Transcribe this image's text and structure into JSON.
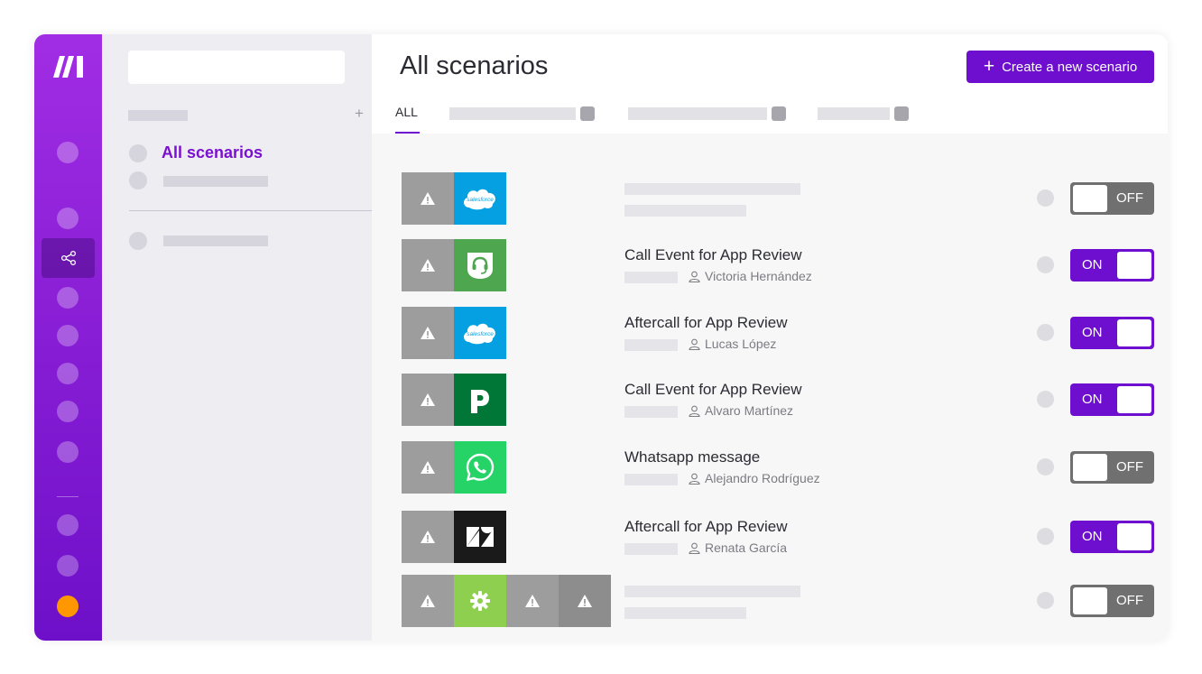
{
  "page": {
    "title": "All scenarios",
    "create_button": "Create a new scenario"
  },
  "sidebar": {
    "active_item": "All scenarios"
  },
  "tabs": {
    "all": "ALL"
  },
  "colors": {
    "accent": "#6e0fd0",
    "rail_top": "#a12de4",
    "toggle_off": "#707070"
  },
  "scenarios": [
    {
      "title": "",
      "owner": "",
      "state": "OFF",
      "modules": [
        "warning-icon",
        "salesforce-icon"
      ]
    },
    {
      "title": "Call Event for App Review",
      "owner": "Victoria Hernández",
      "state": "ON",
      "modules": [
        "warning-icon",
        "headset-icon"
      ]
    },
    {
      "title": "Aftercall for App Review",
      "owner": "Lucas López",
      "state": "ON",
      "modules": [
        "warning-icon",
        "salesforce-icon"
      ]
    },
    {
      "title": "Call Event for App Review",
      "owner": "Alvaro Martínez",
      "state": "ON",
      "modules": [
        "warning-icon",
        "pipedrive-icon"
      ]
    },
    {
      "title": "Whatsapp message",
      "owner": "Alejandro Rodríguez",
      "state": "OFF",
      "modules": [
        "warning-icon",
        "whatsapp-icon"
      ]
    },
    {
      "title": "Aftercall for App Review",
      "owner": "Renata García",
      "state": "ON",
      "modules": [
        "warning-icon",
        "zendesk-icon"
      ]
    },
    {
      "title": "",
      "owner": "",
      "state": "OFF",
      "modules": [
        "warning-icon",
        "gear-icon",
        "warning-icon",
        "warning-icon"
      ]
    }
  ]
}
